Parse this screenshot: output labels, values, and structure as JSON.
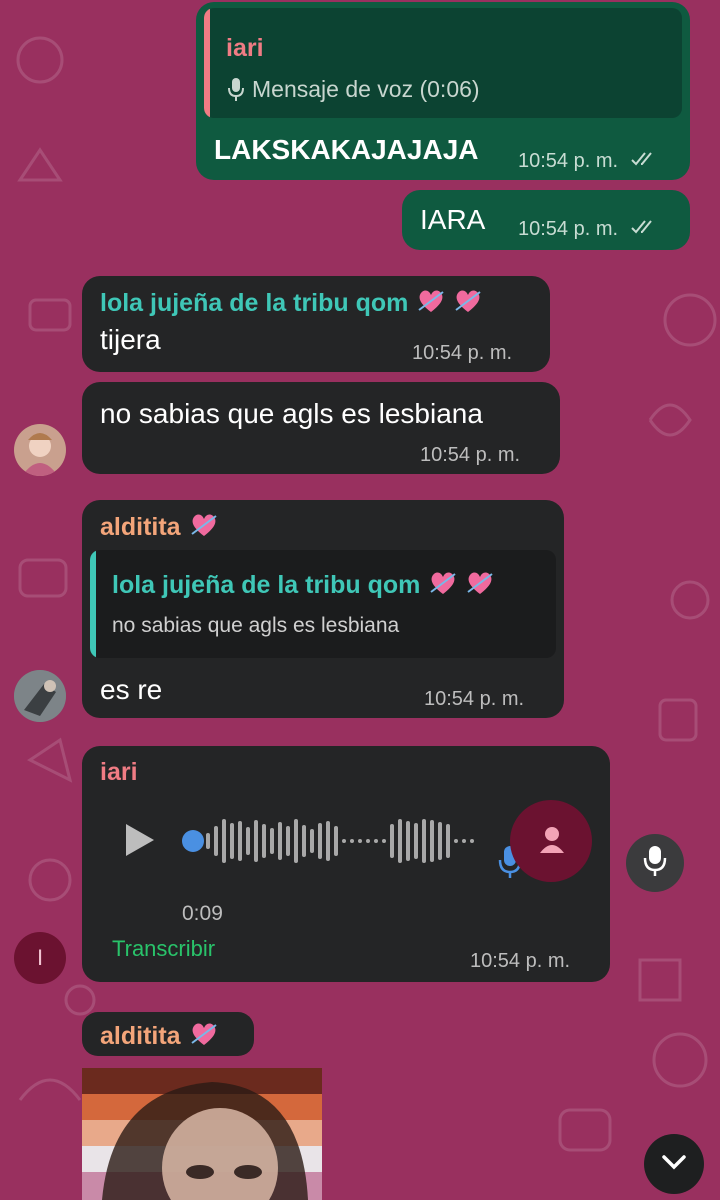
{
  "colors": {
    "background": "#99305f",
    "outgoing_bubble": "#0f5a40",
    "incoming_bubble": "#242526",
    "quote_out_bg": "#0c4332",
    "quote_in_bg": "#1b1c1d",
    "sender_iari": "#f07c84",
    "sender_lola": "#3fc7b7",
    "sender_alditita": "#f3a57a",
    "transcribe": "#29c36a",
    "play_dot": "#4a90e2",
    "mic_blue": "#4a90e2"
  },
  "messages": [
    {
      "quote_sender": "iari",
      "quote_text": "Mensaje de voz (0:06)",
      "text": "LAKSKAKAJAJAJA",
      "time": "10:54 p. m."
    },
    {
      "text": "IARA",
      "time": "10:54 p. m."
    },
    {
      "sender": "lola jujeña de la tribu qom",
      "text": "tijera",
      "time": "10:54 p. m."
    },
    {
      "text": "no sabias que agls es lesbiana",
      "time": "10:54 p. m."
    },
    {
      "sender": "alditita",
      "quote_sender": "lola jujeña de la tribu qom",
      "quote_text": "no sabias que agls es lesbiana",
      "text": "es re",
      "time": "10:54 p. m."
    },
    {
      "sender": "iari",
      "duration": "0:09",
      "transcribe": "Transcribir",
      "time": "10:54 p. m.",
      "avatar_initial": "I"
    },
    {
      "sender": "alditita"
    }
  ]
}
